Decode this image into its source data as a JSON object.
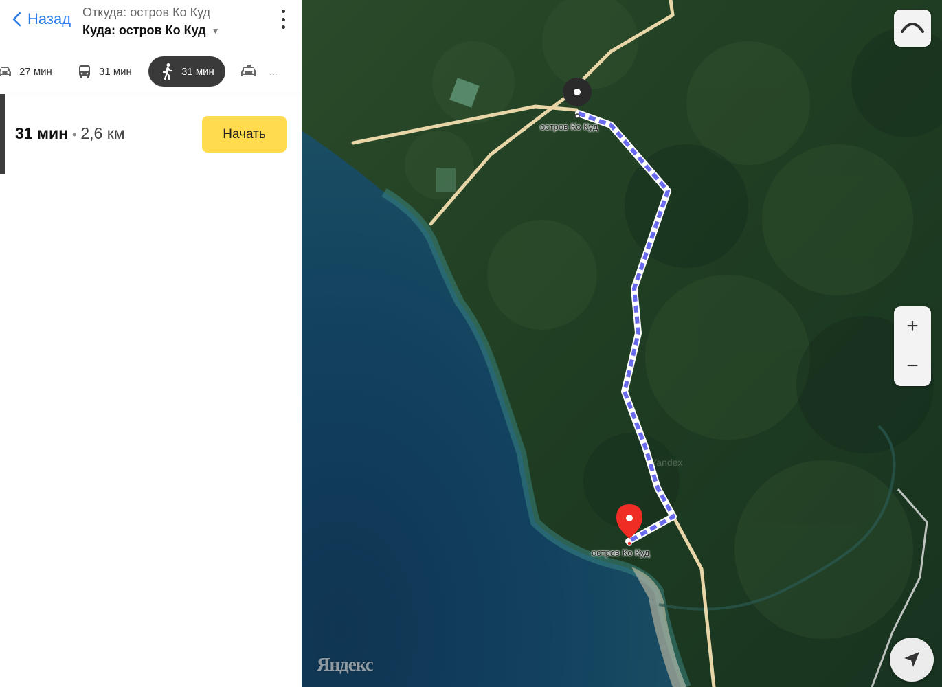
{
  "header": {
    "back_label": "Назад",
    "from_label": "Откуда: остров Ко Куд",
    "to_label": "Куда: остров Ко Куд",
    "caret": "▼"
  },
  "modes": [
    {
      "id": "car",
      "icon": "car-icon",
      "time": "27 мин",
      "active": false
    },
    {
      "id": "bus",
      "icon": "bus-icon",
      "time": "31 мин",
      "active": false
    },
    {
      "id": "walk",
      "icon": "pedestrian-icon",
      "time": "31 мин",
      "active": true
    },
    {
      "id": "taxi",
      "icon": "taxi-icon",
      "time": "...",
      "active": false
    }
  ],
  "route": {
    "time": "31 мин",
    "separator": "•",
    "distance": "2,6 км",
    "start_label": "Начать"
  },
  "map": {
    "start_label": "остров Ко Куд",
    "end_label": "остров Ко Куд",
    "watermark": "Яндекс",
    "faint_watermark": "Yandex",
    "zoom_in": "+",
    "zoom_out": "−",
    "route_color": "#6b6bf0",
    "road_color": "#e8d6a8"
  }
}
